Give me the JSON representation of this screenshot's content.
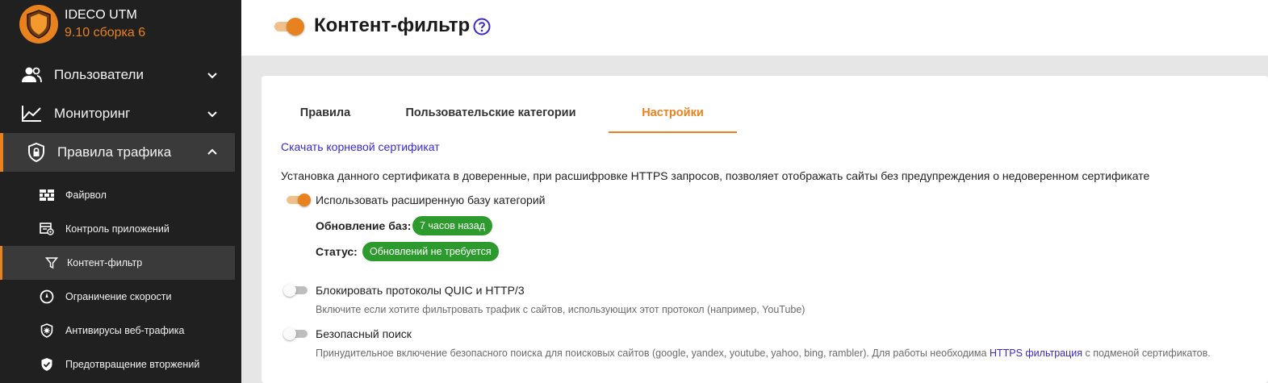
{
  "brand": {
    "name": "IDECO UTM",
    "version": "9.10 сборка 6",
    "logo_icon": "shield-icon",
    "accent_color": "#e8821e"
  },
  "sidebar": {
    "items": [
      {
        "label": "Пользователи",
        "icon": "users-icon"
      },
      {
        "label": "Мониторинг",
        "icon": "chart-line-icon"
      },
      {
        "label": "Правила трафика",
        "icon": "shield-lock-icon"
      }
    ],
    "subitems": [
      {
        "label": "Файрвол",
        "icon": "firewall-icon"
      },
      {
        "label": "Контроль приложений",
        "icon": "app-control-icon"
      },
      {
        "label": "Контент-фильтр",
        "icon": "filter-icon"
      },
      {
        "label": "Ограничение скорости",
        "icon": "speed-icon"
      },
      {
        "label": "Антивирусы веб-трафика",
        "icon": "antivirus-icon"
      },
      {
        "label": "Предотвращение вторжений",
        "icon": "shield-check-icon"
      }
    ]
  },
  "header": {
    "title": "Контент-фильтр",
    "enabled": true,
    "help_icon": "help-icon"
  },
  "tabs": [
    {
      "label": "Правила"
    },
    {
      "label": "Пользовательские категории"
    },
    {
      "label": "Настройки"
    }
  ],
  "settings": {
    "cert_link": "Скачать корневой сертификат",
    "cert_description": "Установка данного сертификата в доверенные, при расшифровке HTTPS запросов, позволяет отображать сайты без предупреждения о недоверенном сертификате",
    "extended_db": {
      "label": "Использовать расширенную базу категорий",
      "enabled": true,
      "update_label": "Обновление баз:",
      "update_value": "7 часов назад",
      "status_label": "Статус:",
      "status_value": "Обновлений не требуется",
      "badge_color": "#2c9a2c"
    },
    "quic": {
      "label": "Блокировать протоколы QUIC и HTTP/3",
      "enabled": false,
      "hint": "Включите если хотите фильтровать трафик с сайтов, использующих этот протокол (например, YouTube)"
    },
    "safe_search": {
      "label": "Безопасный поиск",
      "enabled": false,
      "hint_before": "Принудительное включение безопасного поиска для поисковых сайтов (google, yandex, youtube, yahoo, bing, rambler). Для работы необходима ",
      "hint_link": "HTTPS фильтрация",
      "hint_after": " с подменой сертификатов."
    }
  }
}
